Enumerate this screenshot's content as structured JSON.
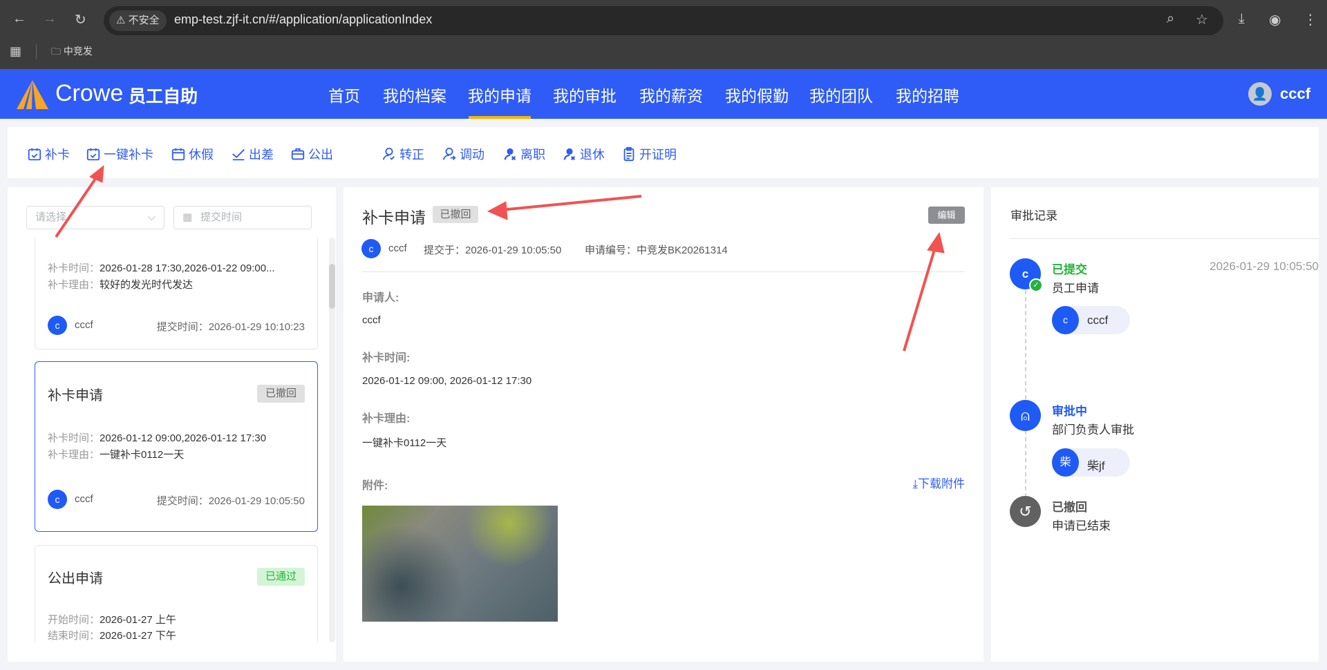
{
  "browser": {
    "security": "不安全",
    "url": "emp-test.zjf-it.cn/#/application/applicationIndex",
    "bookmark": "中竞发"
  },
  "header": {
    "brand": "Crowe",
    "app": "员工自助",
    "nav": [
      "首页",
      "我的档案",
      "我的申请",
      "我的审批",
      "我的薪资",
      "我的假勤",
      "我的团队",
      "我的招聘"
    ],
    "active": "我的申请",
    "user": "cccf",
    "accent": "#2f5cf6"
  },
  "toolbar": [
    "补卡",
    "一键补卡",
    "休假",
    "出差",
    "公出",
    "转正",
    "调动",
    "离职",
    "退休",
    "开证明"
  ],
  "filters": {
    "select_placeholder": "请选择",
    "date_placeholder": "提交时间"
  },
  "list": [
    {
      "lines": [
        [
          "补卡时间：",
          "2026-01-28 17:30,2026-01-22 09:00..."
        ],
        [
          "补卡理由：",
          "较好的发光时代发达"
        ]
      ],
      "user_initial": "c",
      "user": "cccf",
      "submitted": "提交时间：2026-01-29 10:10:23"
    },
    {
      "title": "补卡申请",
      "status": "已撤回",
      "lines": [
        [
          "补卡时间：",
          "2026-01-12 09:00,2026-01-12 17:30"
        ],
        [
          "补卡理由：",
          "一键补卡0112一天"
        ]
      ],
      "user_initial": "c",
      "user": "cccf",
      "submitted": "提交时间：2026-01-29 10:05:50"
    },
    {
      "title": "公出申请",
      "status": "已通过",
      "lines": [
        [
          "开始时间：",
          "2026-01-27 上午"
        ],
        [
          "结束时间：",
          "2026-01-27 下午"
        ]
      ]
    }
  ],
  "detail": {
    "title": "补卡申请",
    "status": "已撤回",
    "edit": "编辑",
    "user_initial": "c",
    "user": "cccf",
    "submitted": "提交于：2026-01-29 10:05:50",
    "number": "申请编号：中竞发BK20261314",
    "fields": [
      {
        "label": "申请人:",
        "value": "cccf"
      },
      {
        "label": "补卡时间:",
        "value": "2026-01-12 09:00, 2026-01-12 17:30"
      },
      {
        "label": "补卡理由:",
        "value": "一键补卡0112一天"
      }
    ],
    "attachment_label": "附件:",
    "download": "下载附件"
  },
  "approval": {
    "title": "审批记录",
    "steps": [
      {
        "status": "已提交",
        "desc": "员工申请",
        "time": "2026-01-29 10:05:50",
        "initial": "c",
        "person": "cccf",
        "color": "#22b43a"
      },
      {
        "status": "审批中",
        "desc": "部门负责人审批",
        "initial": "柴",
        "person": "柴jf",
        "color": "#1e5af6"
      },
      {
        "status": "已撤回",
        "desc": "申请已结束",
        "color": "#555555"
      }
    ]
  }
}
